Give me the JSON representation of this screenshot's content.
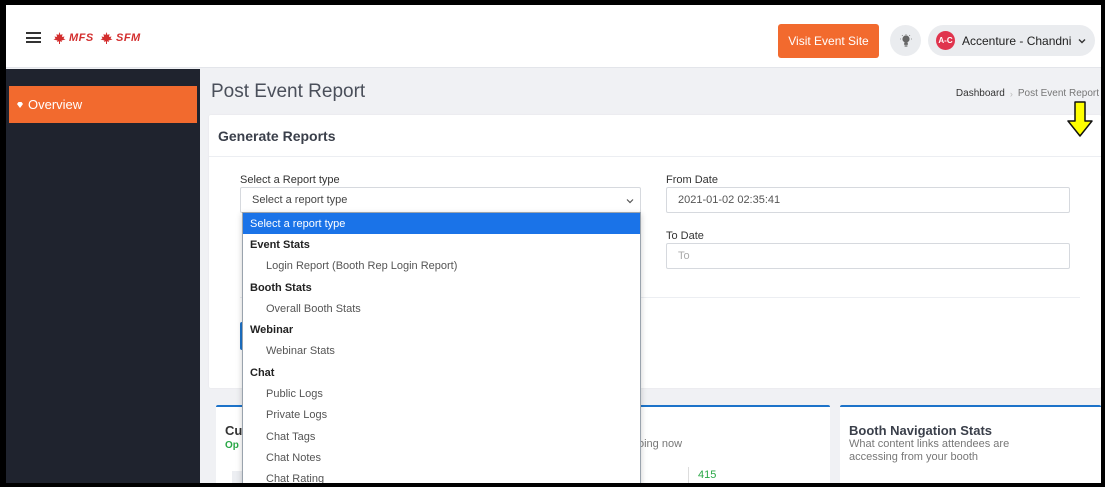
{
  "header": {
    "brand_primary": "MFS",
    "brand_secondary": "SFM",
    "visit_button": "Visit Event Site",
    "user_avatar": "A-C",
    "user_name": "Accenture - Chandni"
  },
  "sidebar": {
    "items": [
      {
        "label": "Overview",
        "icon": "gem-icon",
        "active": true
      }
    ]
  },
  "page": {
    "title": "Post Event Report",
    "breadcrumb": [
      "Dashboard",
      "Post Event Report"
    ]
  },
  "report_card": {
    "title": "Generate Reports",
    "report_type_label": "Select a Report type",
    "report_type_placeholder": "Select a report type",
    "from_date_label": "From Date",
    "from_date_value": "2021-01-02 02:35:41",
    "to_date_label": "To Date",
    "to_date_placeholder": "To"
  },
  "dropdown": {
    "options": [
      {
        "label": "Select a report type",
        "type": "selected"
      },
      {
        "label": "Event Stats",
        "type": "group"
      },
      {
        "label": "Login Report (Booth Rep Login Report)",
        "type": "option"
      },
      {
        "label": "Booth Stats",
        "type": "group"
      },
      {
        "label": "Overall Booth Stats",
        "type": "option"
      },
      {
        "label": "Webinar",
        "type": "group"
      },
      {
        "label": "Webinar Stats",
        "type": "option"
      },
      {
        "label": "Chat",
        "type": "group"
      },
      {
        "label": "Public Logs",
        "type": "option"
      },
      {
        "label": "Private Logs",
        "type": "option"
      },
      {
        "label": "Chat Tags",
        "type": "option"
      },
      {
        "label": "Chat Notes",
        "type": "option"
      },
      {
        "label": "Chat Rating",
        "type": "option"
      }
    ]
  },
  "bottom_cards": {
    "current": {
      "title_fragment": "Cu",
      "subtitle_fragment": "Op",
      "now_text": "oing now",
      "count": "415",
      "count_label_fragment": "ns"
    },
    "booth_navigation": {
      "title": "Booth Navigation Stats",
      "description": "What content links attendees are accessing from your booth"
    }
  },
  "colors": {
    "accent": "#f26a2e",
    "sidebar_bg": "#1f232e",
    "brand_red": "#d32e2e",
    "select_blue": "#1a73e8",
    "card_border_blue": "#1d73c9",
    "annotation_arrow": "#ffff00"
  }
}
